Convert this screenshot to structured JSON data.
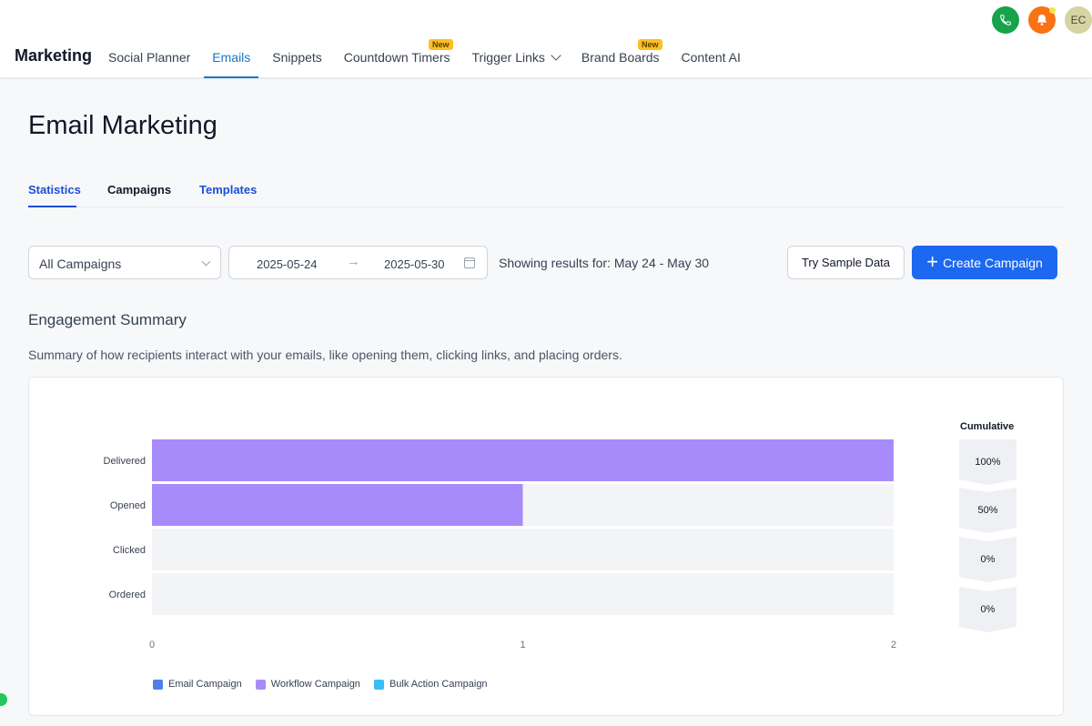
{
  "header": {
    "brand": "Marketing",
    "nav": [
      {
        "label": "Social Planner",
        "active": false,
        "badge": ""
      },
      {
        "label": "Emails",
        "active": true,
        "badge": ""
      },
      {
        "label": "Snippets",
        "active": false,
        "badge": ""
      },
      {
        "label": "Countdown Timers",
        "active": false,
        "badge": "New"
      },
      {
        "label": "Trigger Links",
        "active": false,
        "badge": "",
        "dropdown": true
      },
      {
        "label": "Brand Boards",
        "active": false,
        "badge": "New"
      },
      {
        "label": "Content AI",
        "active": false,
        "badge": ""
      }
    ],
    "avatar_initials": "EC",
    "icons": {
      "phone": "phone-icon",
      "bell": "bell-icon"
    },
    "colors": {
      "phone": "#16a34a",
      "bell": "#f97316",
      "accent": "#1677c8"
    }
  },
  "page": {
    "title": "Email Marketing",
    "tabs": [
      "Statistics",
      "Campaigns",
      "Templates"
    ],
    "active_tab": "Statistics"
  },
  "filters": {
    "campaign_select": "All Campaigns",
    "date_from": "2025-05-24",
    "date_to": "2025-05-30",
    "showing": "Showing results for: May 24 - May 30"
  },
  "actions": {
    "sample": "Try Sample Data",
    "create": "Create Campaign"
  },
  "engagement": {
    "title": "Engagement Summary",
    "description": "Summary of how recipients interact with your emails, like opening them, clicking links, and placing orders.",
    "cumulative_title": "Cumulative",
    "cumulative": [
      "100%",
      "50%",
      "0%",
      "0%"
    ]
  },
  "chart_data": {
    "type": "bar",
    "orientation": "horizontal",
    "categories": [
      "Delivered",
      "Opened",
      "Clicked",
      "Ordered"
    ],
    "series": [
      {
        "name": "Email Campaign",
        "color": "#4f7fe8",
        "values": [
          0,
          0,
          0,
          0
        ]
      },
      {
        "name": "Workflow Campaign",
        "color": "#a78bfa",
        "values": [
          2,
          1,
          0,
          0
        ]
      },
      {
        "name": "Bulk Action Campaign",
        "color": "#38bdf8",
        "values": [
          0,
          0,
          0,
          0
        ]
      }
    ],
    "xlim": [
      0,
      2
    ],
    "xticks": [
      "0",
      "1",
      "2"
    ],
    "legend": "bottom-left",
    "grid": false
  }
}
